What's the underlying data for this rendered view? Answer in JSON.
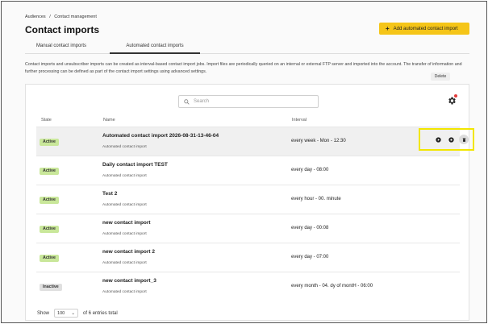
{
  "breadcrumb": {
    "item1": "Audiences",
    "separator": "/",
    "item2": "Contact management"
  },
  "page": {
    "title": "Contact imports"
  },
  "toolbar": {
    "add_label": "Add automated contact import",
    "add_icon": "plus-icon"
  },
  "tabs": [
    {
      "label": "Manual contact imports",
      "active": false
    },
    {
      "label": "Automated contact imports",
      "active": true
    }
  ],
  "description": "Contact imports and unsubscriber imports can be created as interval-based contact import jobs. Import files are periodically queried on an internal or external FTP server and imported into the account. The transfer of information and further processing can be defined as part of the contact import settings using advanced settings.",
  "search": {
    "placeholder": "Search"
  },
  "table": {
    "headers": {
      "state": "State",
      "name": "Name",
      "interval": "Interval"
    },
    "rows": [
      {
        "state": "Active",
        "name": "Automated contact import 2026-08-31-13-46-04",
        "type": "Automated contact import",
        "interval": "every week - Mon - 12:30"
      },
      {
        "state": "Active",
        "name": "Daily contact import TEST",
        "type": "Automated contact import",
        "interval": "every day - 08:00"
      },
      {
        "state": "Active",
        "name": "Test 2",
        "type": "Automated contact import",
        "interval": "every hour - 00. minute"
      },
      {
        "state": "Active",
        "name": "new contact import",
        "type": "Automated contact import",
        "interval": "every day - 00:08"
      },
      {
        "state": "Active",
        "name": "new contact import 2",
        "type": "Automated contact import",
        "interval": "every day - 07:00"
      },
      {
        "state": "Inactive",
        "name": "new contact import_3",
        "type": "Automated contact import",
        "interval": "every month - 04. dy of montH - 06:00"
      }
    ]
  },
  "tooltip": {
    "text": "Delete"
  },
  "footer": {
    "show_label": "Show",
    "page_size": "100",
    "total_label": "of 6 entries total"
  },
  "colors": {
    "accent": "#f5c518",
    "active_badge": "#c9e79a",
    "inactive_badge": "#e0e0e0",
    "highlight": "#f2e600",
    "notification_dot": "#e23b3b"
  }
}
